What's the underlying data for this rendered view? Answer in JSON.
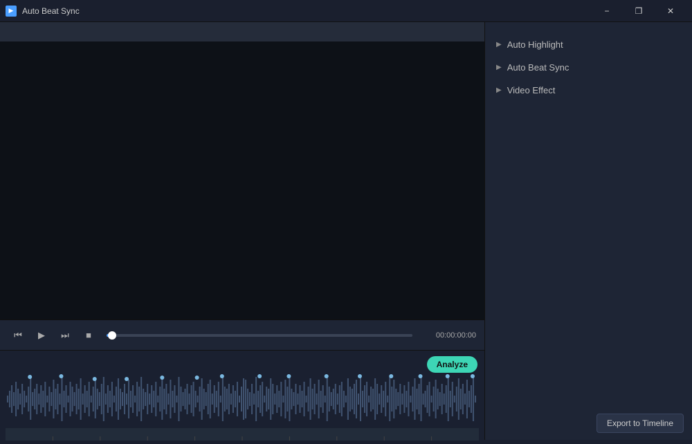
{
  "app": {
    "title": "Auto Beat Sync"
  },
  "titlebar": {
    "title": "Auto Beat Sync",
    "minimize_label": "−",
    "restore_label": "❐",
    "close_label": "✕"
  },
  "playback": {
    "skip_back_icon": "⏮",
    "play_icon": "▶",
    "skip_forward_icon": "⏭",
    "stop_icon": "■",
    "time": "00:00:00:00"
  },
  "waveform": {
    "analyze_label": "Analyze"
  },
  "right_panel": {
    "items": [
      {
        "label": "Auto Highlight"
      },
      {
        "label": "Auto Beat Sync"
      },
      {
        "label": "Video Effect"
      }
    ]
  },
  "footer": {
    "export_label": "Export to Timeline"
  }
}
